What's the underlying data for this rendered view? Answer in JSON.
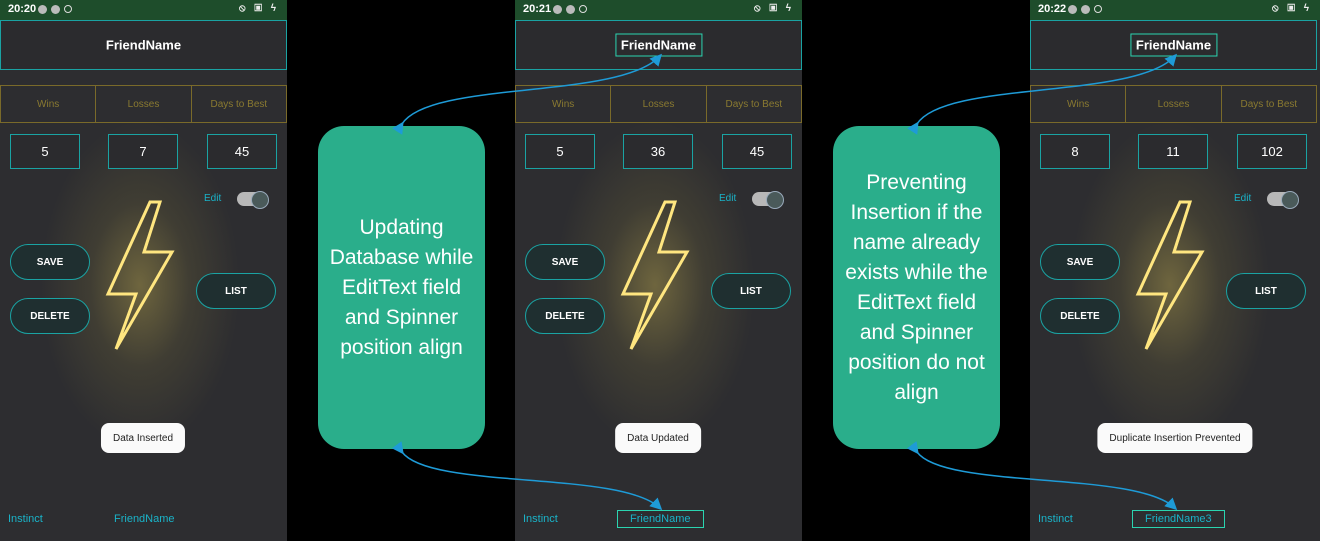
{
  "screens": [
    {
      "time": "20:20",
      "title": "FriendName",
      "headers": [
        "Wins",
        "Losses",
        "Days to Best"
      ],
      "values": [
        "5",
        "7",
        "45"
      ],
      "edit_label": "Edit",
      "save": "SAVE",
      "delete": "DELETE",
      "list": "LIST",
      "toast": "Data Inserted",
      "footer_left": "Instinct",
      "footer_right": "FriendName"
    },
    {
      "time": "20:21",
      "title": "FriendName",
      "headers": [
        "Wins",
        "Losses",
        "Days to Best"
      ],
      "values": [
        "5",
        "36",
        "45"
      ],
      "edit_label": "Edit",
      "save": "SAVE",
      "delete": "DELETE",
      "list": "LIST",
      "toast": "Data Updated",
      "footer_left": "Instinct",
      "footer_right": "FriendName"
    },
    {
      "time": "20:22",
      "title": "FriendName",
      "headers": [
        "Wins",
        "Losses",
        "Days to Best"
      ],
      "values": [
        "8",
        "11",
        "102"
      ],
      "edit_label": "Edit",
      "save": "SAVE",
      "delete": "DELETE",
      "list": "LIST",
      "toast": "Duplicate Insertion Prevented",
      "footer_left": "Instinct",
      "footer_right": "FriendName3"
    }
  ],
  "callouts": {
    "update": "Updating Database while EditText field and Spinner position align",
    "prevent": "Preventing Insertion if the name already exists while the EditText field and Spinner position do not align"
  },
  "colors": {
    "accent": "#1aa3a3",
    "callout": "#2aae8b",
    "arrow": "#1e9bd7",
    "statusbar": "#1e4d2b"
  }
}
